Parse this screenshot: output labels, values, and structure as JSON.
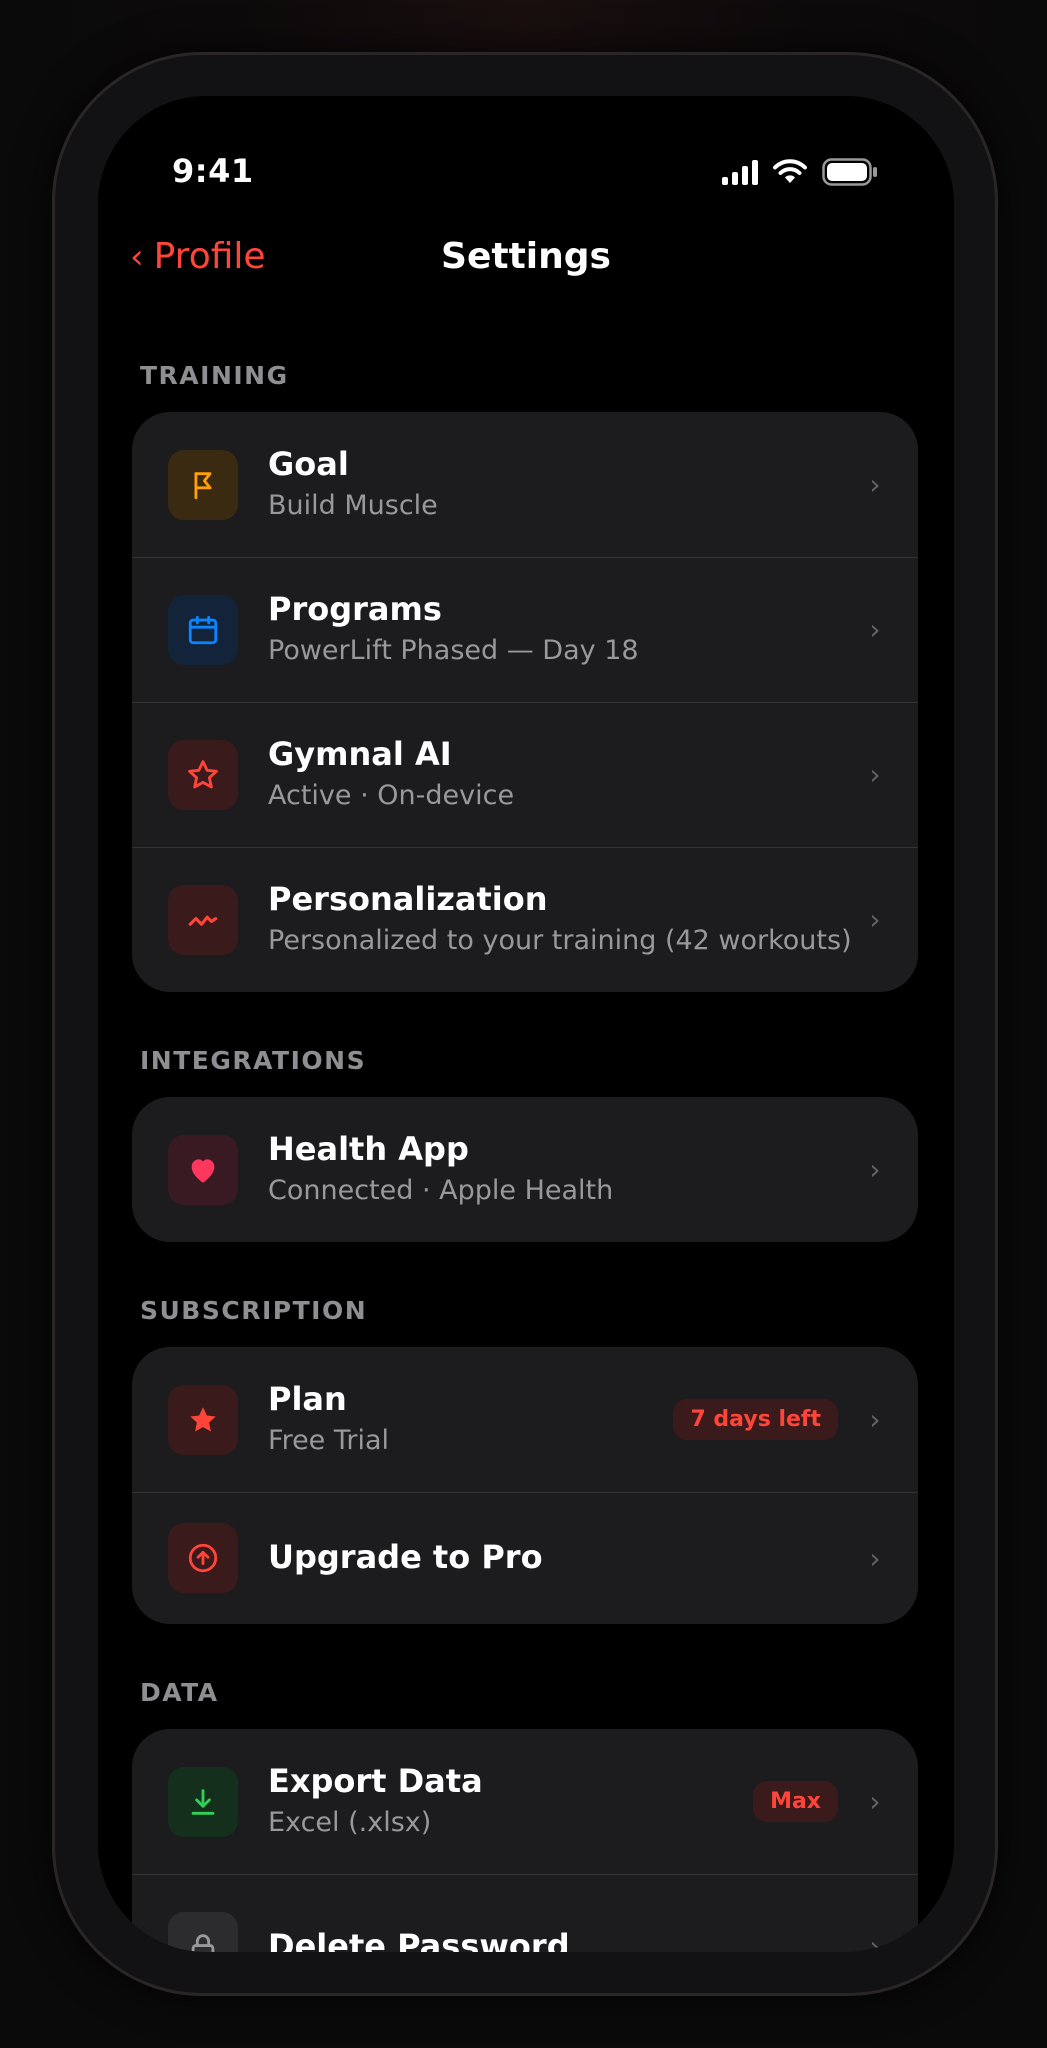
{
  "status_bar": {
    "time": "9:41"
  },
  "nav": {
    "back_label": "Profile",
    "title": "Settings"
  },
  "sections": {
    "training": {
      "label": "TRAINING",
      "rows": {
        "goal": {
          "title": "Goal",
          "subtitle": "Build Muscle",
          "icon": "flag-icon",
          "icon_color": "#ff9f0a",
          "icon_bg": "#3a2a12"
        },
        "programs": {
          "title": "Programs",
          "subtitle": "PowerLift Phased — Day 18",
          "icon": "calendar-icon",
          "icon_color": "#0a84ff",
          "icon_bg": "#12233a"
        },
        "ai": {
          "title": "Gymnal AI",
          "subtitle": "Active · On-device",
          "icon": "star-outline-icon",
          "icon_color": "#ff453a",
          "icon_bg": "#3a1a1a"
        },
        "personalization": {
          "title": "Personalization",
          "subtitle": "Personalized to your training (42 workouts)",
          "icon": "activity-icon",
          "icon_color": "#ff453a",
          "icon_bg": "#3a1a1a"
        }
      }
    },
    "integrations": {
      "label": "INTEGRATIONS",
      "rows": {
        "health": {
          "title": "Health App",
          "subtitle": "Connected · Apple Health",
          "icon": "heart-icon",
          "icon_color": "#ff375f",
          "icon_bg": "#3a1a22"
        }
      }
    },
    "subscription": {
      "label": "SUBSCRIPTION",
      "rows": {
        "plan": {
          "title": "Plan",
          "subtitle": "Free Trial",
          "badge": "7 days left",
          "icon": "star-filled-icon",
          "icon_color": "#ff453a",
          "icon_bg": "#3a1a1a"
        },
        "upgrade": {
          "title": "Upgrade to Pro",
          "icon": "arrow-up-circle-icon",
          "icon_color": "#ff453a",
          "icon_bg": "#3a1a1a"
        }
      }
    },
    "data": {
      "label": "DATA",
      "rows": {
        "export": {
          "title": "Export Data",
          "subtitle": "Excel (.xlsx)",
          "badge": "Max",
          "icon": "download-icon",
          "icon_color": "#30d158",
          "icon_bg": "#14301c"
        },
        "delete_password": {
          "title": "Delete Password",
          "icon": "lock-icon",
          "icon_color": "#98989d",
          "icon_bg": "#2c2c2e"
        }
      }
    }
  }
}
